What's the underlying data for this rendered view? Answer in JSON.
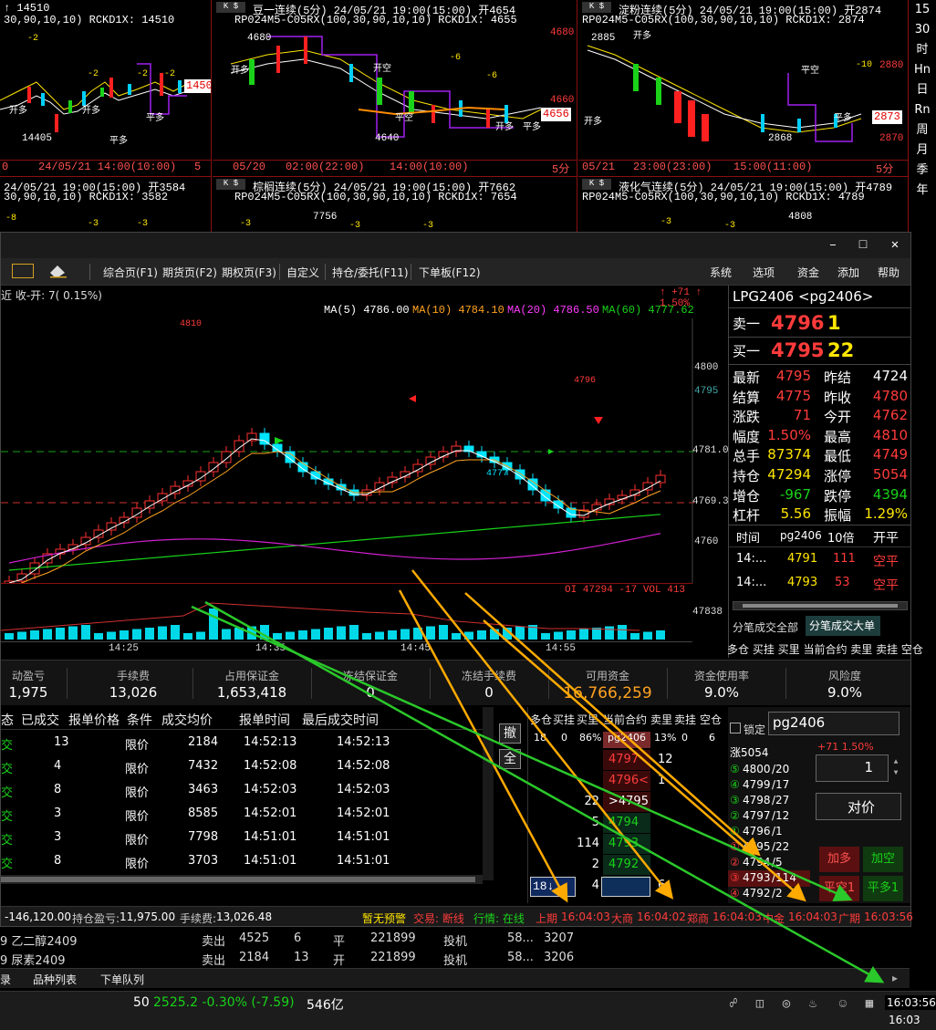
{
  "mini_charts": [
    {
      "title": "↑ 14510",
      "sub": "30,90,10,10) RCKD1X: 14510",
      "axis_left": "0",
      "axis_mid": "24/05/21 14:00(10:00)",
      "axis_right": "5分",
      "price": "14505",
      "low_label": "14405",
      "labels": [
        "-2",
        "-2",
        "-2",
        "-2",
        "开多",
        "开多",
        "平多",
        "平多"
      ]
    },
    {
      "title": "豆一连续(5分) 24/05/21 19:00(15:00) 开4654",
      "sub": "RP024M5-C05RX(100,30,90,10,10) RCKD1X: 4655",
      "axis_left": "05/20",
      "axis_mid": "02:00(22:00)",
      "axis_mid2": "14:00(10:00)",
      "axis_right": "5分",
      "price": "4656",
      "high_label": "4680",
      "low_label": "4640",
      "tick_high": "4680",
      "tick_mid": "4660",
      "labels": [
        "开空",
        "-6",
        "-6",
        "开多",
        "平空",
        "开多",
        "平多"
      ]
    },
    {
      "title": "淀粉连续(5分) 24/05/21 19:00(15:00) 开2874",
      "sub": "RP024M5-C05RX(100,30,90,10,10) RCKD1X: 2874",
      "axis_left": "05/21",
      "axis_mid": "23:00(23:00)",
      "axis_mid2": "15:00(11:00)",
      "axis_right": "5分",
      "price": "2873",
      "high_label": "2885",
      "low_label": "2868",
      "tick_high": "2880",
      "tick_low": "2870",
      "labels": [
        "开多",
        "-10",
        "平空",
        "平多",
        "开多"
      ]
    },
    {
      "title": "24/05/21 19:00(15:00) 开3584",
      "sub": "30,90,10,10) RCKD1X: 3582",
      "labels": [
        "-8",
        "-3",
        "-3"
      ]
    },
    {
      "title": "棕榈连续(5分) 24/05/21 19:00(15:00) 开7662",
      "sub": "RP024M5-C05RX(100,30,90,10,10) RCKD1X: 7654",
      "high_label": "7756",
      "labels": [
        "-3",
        "-3",
        "-3"
      ]
    },
    {
      "title": "液化气连续(5分) 24/05/21 19:00(15:00) 开4789",
      "sub": "RP024M5-C05RX(100,30,90,10,10) RCKD1X: 4789",
      "high_label": "4808",
      "labels": [
        "-3",
        "-3"
      ]
    }
  ],
  "side_periods": [
    "15",
    "30",
    "时",
    "Hn",
    "日",
    "Rn",
    "周",
    "月",
    "季",
    "年"
  ],
  "toolbar": {
    "items": [
      "综合页(F1)",
      "期货页(F2)",
      "期权页(F3)",
      "自定义",
      "持仓/委托(F11)",
      "下单板(F12)"
    ],
    "right": [
      "系统",
      "选项",
      "资金",
      "添加",
      "帮助"
    ]
  },
  "chart": {
    "header_left": "近 收-开: 7( 0.15%)",
    "header_right": "↑ +71  ↑ 1.50%",
    "ma5": "MA(5) 4786.00",
    "ma10": "MA(10) 4784.10",
    "ma20": "MA(20) 4786.50",
    "ma60": "MA(60) 4777.62",
    "peak": "4810",
    "recent_high": "4796",
    "low": "4777",
    "y_ticks": [
      "4800",
      "4795",
      "4781.0",
      "4769.3",
      "4760"
    ],
    "vol_header": "OI 47294 -17  VOL 413",
    "vol_tick": "47838",
    "x_ticks": [
      "14:25",
      "14:35",
      "14:45",
      "14:55"
    ]
  },
  "quote": {
    "symbol": "LPG2406 <pg2406>",
    "ask_label": "卖一",
    "ask_price": "4796",
    "ask_vol": "1",
    "bid_label": "买一",
    "bid_price": "4795",
    "bid_vol": "22",
    "rows": [
      {
        "l1": "最新",
        "v1": "4795",
        "c1": "red",
        "l2": "昨结",
        "v2": "4724",
        "c2": "white"
      },
      {
        "l1": "结算",
        "v1": "4775",
        "c1": "red",
        "l2": "昨收",
        "v2": "4780",
        "c2": "red"
      },
      {
        "l1": "涨跌",
        "v1": "71",
        "c1": "red",
        "l2": "今开",
        "v2": "4762",
        "c2": "red"
      },
      {
        "l1": "幅度",
        "v1": "1.50%",
        "c1": "red",
        "l2": "最高",
        "v2": "4810",
        "c2": "red"
      },
      {
        "l1": "总手",
        "v1": "87374",
        "c1": "yellow",
        "l2": "最低",
        "v2": "4749",
        "c2": "red"
      },
      {
        "l1": "持仓",
        "v1": "47294",
        "c1": "yellow",
        "l2": "涨停",
        "v2": "5054",
        "c2": "red"
      },
      {
        "l1": "增仓",
        "v1": "-967",
        "c1": "green",
        "l2": "跌停",
        "v2": "4394",
        "c2": "green"
      },
      {
        "l1": "杠杆",
        "v1": "5.56",
        "c1": "yellow",
        "l2": "振幅",
        "v2": "1.29%",
        "c2": "yellow"
      }
    ],
    "tick_header": [
      "时间",
      "pg2406",
      "10倍",
      "开平"
    ],
    "ticks": [
      {
        "t": "14:...",
        "p": "4791",
        "v": "111",
        "k": "空平"
      },
      {
        "t": "14:...",
        "p": "4793",
        "v": "53",
        "k": "空平"
      }
    ],
    "tab_all": "分笔成交全部",
    "tab_big": "分笔成交大单",
    "legend": "多仓 买挂 买里 当前合约 卖里 卖挂 空仓"
  },
  "account": [
    {
      "label": "动盈亏",
      "value": "1,975"
    },
    {
      "label": "手续费",
      "value": "13,026"
    },
    {
      "label": "占用保证金",
      "value": "1,653,418"
    },
    {
      "label": "冻结保证金",
      "value": "0"
    },
    {
      "label": "冻结手续费",
      "value": "0"
    },
    {
      "label": "可用资金",
      "value": "16,766,259"
    },
    {
      "label": "资金使用率",
      "value": "9.0%"
    },
    {
      "label": "风险度",
      "value": "9.0%"
    }
  ],
  "orders": {
    "headers": [
      "态",
      "已成交",
      "报单价格",
      "条件",
      "成交均价",
      "报单时间",
      "最后成交时间"
    ],
    "rows": [
      {
        "s": "交",
        "q": "13",
        "c": "限价",
        "avg": "2184",
        "t1": "14:52:13",
        "t2": "14:52:13"
      },
      {
        "s": "交",
        "q": "4",
        "c": "限价",
        "avg": "7432",
        "t1": "14:52:08",
        "t2": "14:52:08"
      },
      {
        "s": "交",
        "q": "8",
        "c": "限价",
        "avg": "3463",
        "t1": "14:52:03",
        "t2": "14:52:03"
      },
      {
        "s": "交",
        "q": "3",
        "c": "限价",
        "avg": "8585",
        "t1": "14:52:01",
        "t2": "14:52:01"
      },
      {
        "s": "交",
        "q": "3",
        "c": "限价",
        "avg": "7798",
        "t1": "14:51:01",
        "t2": "14:51:01"
      },
      {
        "s": "交",
        "q": "8",
        "c": "限价",
        "avg": "3703",
        "t1": "14:51:01",
        "t2": "14:51:01"
      }
    ],
    "btn_withdraw": "撤",
    "btn_all": "全"
  },
  "ladder": {
    "headers": [
      "多仓",
      "买挂",
      "买里",
      "当前合约",
      "卖里",
      "卖挂",
      "空仓"
    ],
    "first": {
      "a": "18",
      "b": "0",
      "c": "86%",
      "sym": "pg2406",
      "d": "13%",
      "e": "0",
      "f": "6"
    },
    "rows": [
      {
        "price": "4797",
        "right": "12",
        "left": ""
      },
      {
        "price": "4796<",
        "right": "1",
        "left": ""
      },
      {
        "price": ">4795",
        "right": "",
        "left": "22"
      },
      {
        "price": "4794",
        "right": "",
        "left": "5"
      },
      {
        "price": "4793",
        "right": "",
        "left": "114"
      },
      {
        "price": "4792",
        "right": "",
        "left": "2"
      },
      {
        "price": "4791",
        "right": "6",
        "left": "4"
      }
    ],
    "selected_qty": "18↓"
  },
  "entry": {
    "lock": "锁定",
    "symbol": "pg2406",
    "limit_up": "涨5054",
    "change": "+71  1.50%",
    "levels": [
      {
        "n": "⑤",
        "p": "4800",
        "v": "/20"
      },
      {
        "n": "④",
        "p": "4799",
        "v": "/17"
      },
      {
        "n": "③",
        "p": "4798",
        "v": "/27"
      },
      {
        "n": "②",
        "p": "4797",
        "v": "/12"
      },
      {
        "n": "①",
        "p": "4796",
        "v": "/1"
      },
      {
        "n": "①",
        "p": "4795",
        "v": "/22"
      },
      {
        "n": "②",
        "p": "4794",
        "v": "/5"
      },
      {
        "n": "③",
        "p": "4793",
        "v": "/114"
      },
      {
        "n": "④",
        "p": "4792",
        "v": "/2"
      }
    ],
    "qty": "1",
    "price_mode": "对价",
    "btn_long": "加多",
    "btn_short": "加空",
    "btn_close_short": "平空1",
    "btn_close_long": "平多1"
  },
  "status": {
    "pnl": "-146,120.00",
    "hold_label": "持仓盈亏:",
    "hold": "11,975.00",
    "fee_label": "手续费:",
    "fee": "13,026.48",
    "warn": "暂无预警",
    "trade": "交易: 断线",
    "quote": "行情: 在线",
    "ex": [
      {
        "n": "上期",
        "t": "16:04:03"
      },
      {
        "n": "大商",
        "t": "16:04:02"
      },
      {
        "n": "郑商",
        "t": "16:04:03"
      },
      {
        "n": "中金",
        "t": "16:04:03"
      },
      {
        "n": "广期",
        "t": "16:03:56"
      }
    ]
  },
  "positions": [
    {
      "name": "9 乙二醇2409",
      "dir": "卖出",
      "price": "4525",
      "qty": "6",
      "oc": "平",
      "acct": "221899",
      "type": "投机",
      "x": "58...",
      "id": "3207"
    },
    {
      "name": "9 尿素2409",
      "dir": "卖出",
      "price": "2184",
      "qty": "13",
      "oc": "开",
      "acct": "221899",
      "type": "投机",
      "x": "58...",
      "id": "3206"
    }
  ],
  "tabs": [
    "录",
    "品种列表",
    "下单队列"
  ],
  "taskbar": {
    "index_num": "50",
    "index_val": "2525.2 -0.30% (-7.59)",
    "amount": "546亿",
    "clock": "16:03:56",
    "clock2": "16:03"
  }
}
